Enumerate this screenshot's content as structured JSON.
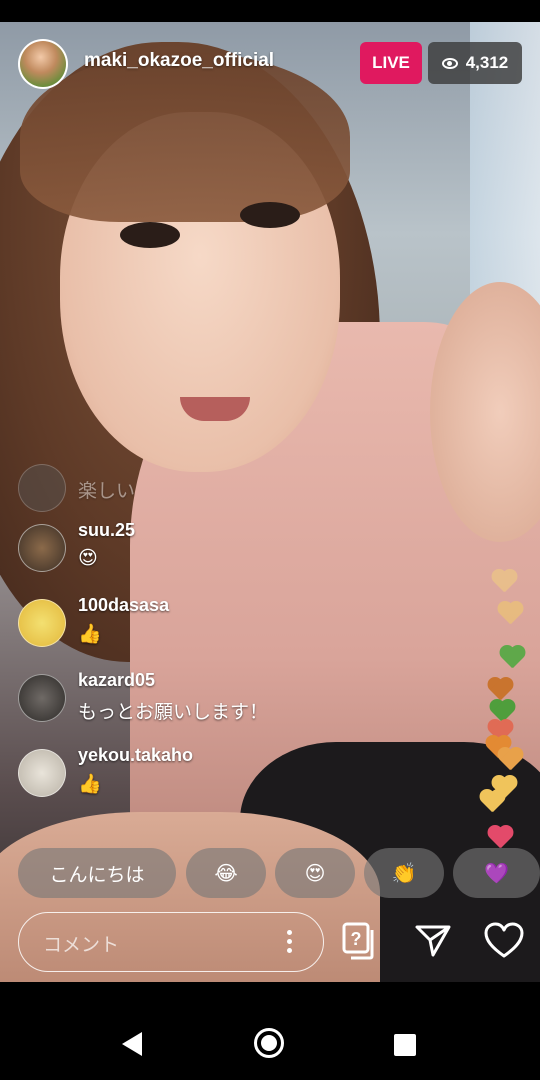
{
  "header": {
    "username": "maki_okazoe_official",
    "live_label": "LIVE",
    "viewer_count": "4,312"
  },
  "comments": [
    {
      "name": "",
      "text": "楽しい",
      "faded": true
    },
    {
      "name": "suu.25",
      "text": "😍"
    },
    {
      "name": "100dasasa",
      "text": "👍"
    },
    {
      "name": "kazard05",
      "text": "もっとお願いします！"
    },
    {
      "name": "yekou.takaho",
      "text": "👍"
    }
  ],
  "quick_reactions": [
    "こんにちは",
    "😂",
    "😍",
    "👏",
    "💜"
  ],
  "comment_input": {
    "placeholder": "コメント"
  },
  "colors": {
    "live_badge": "#e0195f",
    "hearts": [
      "#f4d37a",
      "#f1cc6a",
      "#5fa84a",
      "#c9742e",
      "#4f9e3c",
      "#e06b55",
      "#e38a33",
      "#e8a14a",
      "#f0c45b",
      "#e34a6a"
    ]
  },
  "icons": {
    "viewer": "eye-icon",
    "question_cards": "question-cards-icon",
    "send": "paper-plane-icon",
    "like": "heart-outline-icon",
    "more": "more-vertical-icon"
  }
}
